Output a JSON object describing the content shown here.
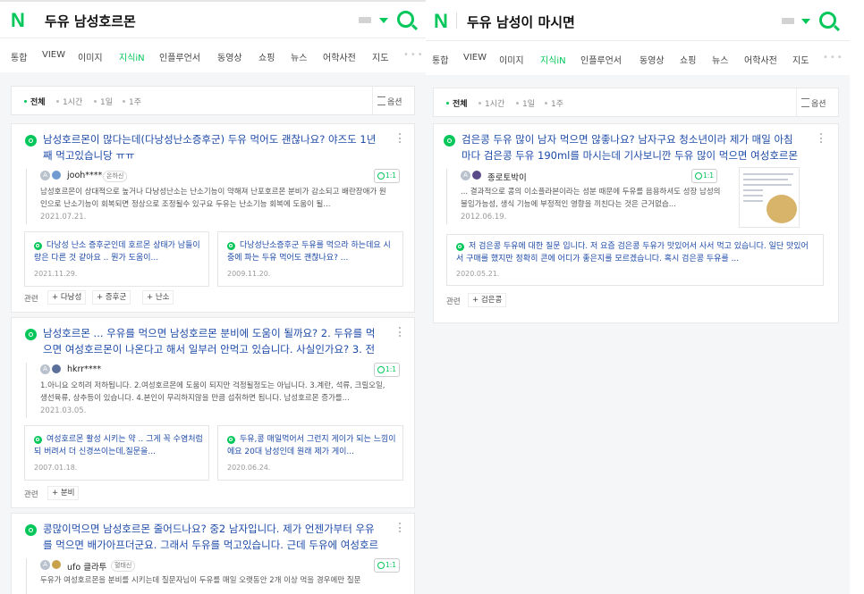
{
  "colors": {
    "brand": "#03c75a",
    "link": "#1d4aa8"
  },
  "left": {
    "logo": "N",
    "query": "두유 남성호르몬",
    "tabs": [
      "통합",
      "VIEW",
      "이미지",
      "지식iN",
      "인플루언서",
      "동영상",
      "쇼핑",
      "뉴스",
      "어학사전",
      "지도"
    ],
    "active_tab": "지식iN",
    "filters": [
      "전체",
      "1시간",
      "1일",
      "1주"
    ],
    "option": "옵션",
    "results": [
      {
        "title": "남성호르몬이 많다는데(다낭성난소증후군) 두유 먹어도 괜찮나요? 야즈도 1년째 먹고있습니당 ㅠㅠ",
        "user": "jooh****",
        "badge": "온하신",
        "count": "1:1",
        "excerpt": "남성호르몬이 상대적으로 높거나 다낭성난소는 난소기능이 약해져 난포호르몬 분비가 감소되고 배란장애가 원인으로 난소기능이 회복되면 정상으로 조정될수 있구요 두유는 난소기능 회복에 도움이 될...",
        "date": "2021.07.21.",
        "subs": [
          {
            "text": "다낭성 난소 증후군인데 호르몬 상태가 남들이랑은 다른 것 같아요 .. 뭔가 도움이...",
            "date": "2021.11.29."
          },
          {
            "text": "다낭성난소증후군 두유를 먹으라 하는데요 시중에 파는 두유 먹어도 괜찮나요? ...",
            "date": "2009.11.20."
          }
        ],
        "related_label": "관련",
        "keywords": [
          "다낭성",
          "증후군",
          "난소"
        ]
      },
      {
        "title": "남성호르몬 ... 우유를 먹으면 남성호르몬 분비에 도움이 될까요? 2. 두유를 먹으면 여성호르몬이 나온다고 해서 일부러 안먹고 있습니다. 사실인가요? 3. 전에 ...",
        "user": "hkrr****",
        "badge": "",
        "count": "1:1",
        "excerpt": "1.아니요 오히려 저하됩니다. 2.여성호르몬에 도움이 되지만 걱정될정도는 아닙니다. 3.계란, 석류, 크릴오일, 생선육류, 상추등이 있습니다. 4.본인이 무리하지않을 만큼 섭취하면 됩니다. 남성호르몬 증가를...",
        "date": "2021.03.05.",
        "subs": [
          {
            "text": "여성호르몬 활성 시키는 약 .. 그게 꼭 수염처럼 되 버려서 더 신경쓰이는데,질문을...",
            "date": "2007.01.18."
          },
          {
            "text": "두유,콩 매일먹어서 그런지 게이가 되는 느낌이에요 20대 남성인데 원래 제가 게이...",
            "date": "2020.06.24."
          }
        ],
        "related_label": "관련",
        "keywords": [
          "분비"
        ]
      },
      {
        "title": "콩많이먹으면 남성호르몬 줄어드나요? 중2 남자입니다. 제가 언젠가부터 우유를 먹으면 배가아프더군요. 그래서 두유를 먹고있습니다. 근데 두유에 여성호르몬...",
        "user": "ufo 클라투",
        "badge": "혈태신",
        "count": "1:1",
        "excerpt": "두유가 여성호르몬을 분비를 시키는데 질문자님이 두유를 매일 오랫동안 2개 이상 먹을 경우에만 질문"
      }
    ]
  },
  "right": {
    "logo": "N",
    "query": "두유 남성이 마시면",
    "tabs": [
      "통합",
      "VIEW",
      "이미지",
      "지식iN",
      "인플루언서",
      "동영상",
      "쇼핑",
      "뉴스",
      "어학사전",
      "지도"
    ],
    "active_tab": "지식iN",
    "filters": [
      "전체",
      "1시간",
      "1일",
      "1주"
    ],
    "option": "옵션",
    "result": {
      "title": "검은콩 두유 많이 남자 먹으면 않좋나요? 남자구요 청소년이라 제가 매일 아침마다 검은콩 두유 190ml를 마시는데 기사보니깐 두유 많이 먹으면 여성호르몬이...",
      "user": "종로토박이",
      "count": "1:1",
      "excerpt": "... 결과적으로 콩의 이소플라본이라는 성분 때문에 두유를 음용하셔도 성장 남성의 불임가능성, 생식 기능에 부정적인 영향을 끼친다는 것은 근거없습...",
      "date": "2012.06.19.",
      "sub": {
        "text": "저 검은콩 두유에 대한 질문 입니다. 저 요즘 검은콩 두유가 맛있어서 사서 먹고 있습니다. 일단 맛있어서 구매를 했지만 정확히 콘에 어디가 좋은지를 모르겠습니다. 혹시 검은콩 두유를 ...",
        "date": "2020.05.21."
      },
      "related_label": "관련",
      "keywords": [
        "검은콩"
      ]
    }
  }
}
